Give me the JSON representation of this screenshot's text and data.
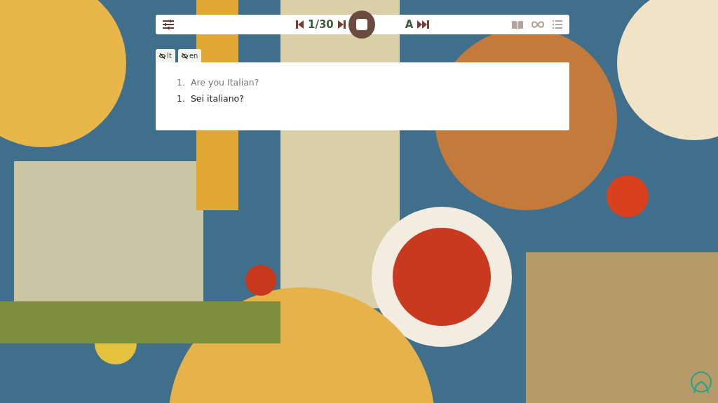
{
  "toolbar": {
    "counter": "1/30",
    "auto_label": "A",
    "playing": true
  },
  "language_tabs": [
    {
      "label": "It",
      "hidden": true
    },
    {
      "label": "en",
      "hidden": true
    }
  ],
  "sentences": [
    {
      "number": "1.",
      "text": "Are you Italian?",
      "kind": "translation"
    },
    {
      "number": "1.",
      "text": "Sei italiano?",
      "kind": "original"
    }
  ]
}
